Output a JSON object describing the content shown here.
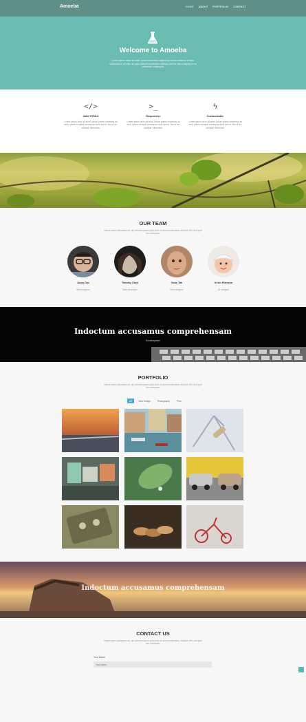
{
  "nav": {
    "brand": "Amoeba",
    "items": [
      "HOME",
      "ABOUT",
      "PORTFOLIO",
      "CONTACT"
    ]
  },
  "hero": {
    "title": "Welcome to Amoeba",
    "text": "Lorem ipsum dolor sit amet, ipsum nonummy adipiscing sed do eiusmod tempor incididunt ut. ut enim ad quis nostrud exercitation ullamco laboris nisi ut aliquip ex ea commodo consequat."
  },
  "features": [
    {
      "icon": "code-icon",
      "glyph": "</>",
      "title": "Valid HTML5",
      "text": "Lorem ipsum dolor sit amet, ipsum primis nonummy ad sem, ipsum volutpat consequat dolor sed ut. Nec a leo volutpat, bibendum."
    },
    {
      "icon": "terminal-icon",
      "glyph": ">_",
      "title": "Responsive",
      "text": "Lorem ipsum dolor sit amet, ipsum primis nonummy ad sem, ipsum volutpat consequat dolor sed ut. Nec a leo volutpat, bibendum."
    },
    {
      "icon": "bolt-icon",
      "glyph": "ϟ",
      "title": "Customizable",
      "text": "Lorem ipsum dolor sit amet, ipsum primis nonummy ad sem, ipsum volutpat consequat dolor sed ut. Nec a leo volutpat, bibendum."
    }
  ],
  "team": {
    "title": "OUR TEAM",
    "subtitle": "Neque porro quisquam est, qui dolorem ipsum quia dolor sit amet consectetur, adipisci velit, sed quia non numquam.",
    "members": [
      {
        "name": "Jason Doe",
        "role": "Web engineer"
      },
      {
        "name": "Timothy Clark",
        "role": "Web developer"
      },
      {
        "name": "Vicky Tan",
        "role": "Web designer"
      },
      {
        "name": "Kevin Peterson",
        "role": "UI designer"
      }
    ]
  },
  "quote": {
    "title": "Indoctum accusamus comprehensam",
    "author": "Bootstraptaste"
  },
  "portfolio": {
    "title": "PORTFOLIO",
    "subtitle": "Neque porro quisquam est, qui dolorem ipsum quia dolor sit amet consectetur, adipisci velit, sed quia non numquam.",
    "filters": [
      "All",
      "Web Design",
      "Photography",
      "Print"
    ]
  },
  "banner": {
    "title": "Indoctum accusamus comprehensam"
  },
  "contact": {
    "title": "CONTACT US",
    "subtitle": "Neque porro quisquam est, qui dolorem ipsum quia dolor sit amet consectetur, adipisci velit, sed quia non numquam.",
    "name_label": "Your Name",
    "name_placeholder": "Your Name"
  },
  "colors": {
    "nav": "#5f8f88",
    "hero": "#6bbdb1",
    "accent": "#4aa9d6"
  }
}
